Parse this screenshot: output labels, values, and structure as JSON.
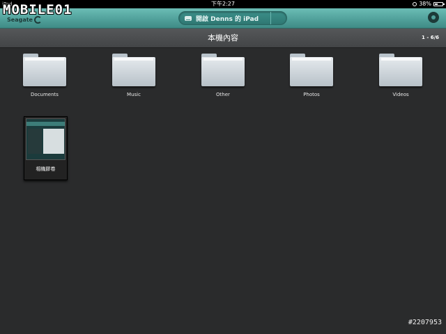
{
  "status_bar": {
    "device": "iPad",
    "time": "下午2:27",
    "battery": "38%",
    "battery_level": 0.38
  },
  "watermark": "MOBILE01",
  "logo": "Seagate",
  "open_button_label": "開啟 Denns 的 iPad",
  "title": "本機內容",
  "count": "1 - 6/6",
  "folders": [
    {
      "label": "Documents"
    },
    {
      "label": "Music"
    },
    {
      "label": "Other"
    },
    {
      "label": "Photos"
    },
    {
      "label": "Videos"
    }
  ],
  "album": {
    "label": "相機膠卷"
  },
  "photo_id": "#2207953"
}
